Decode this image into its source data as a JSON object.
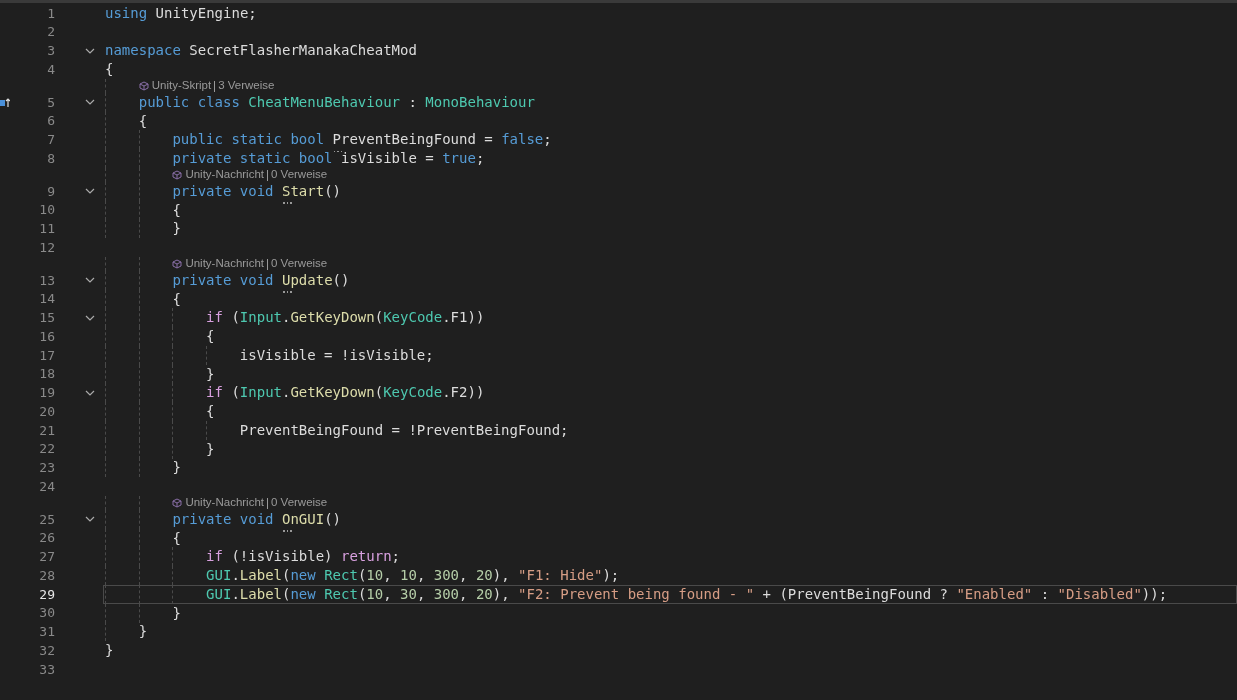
{
  "editor": {
    "lines": [
      {
        "number": "1",
        "foldable": false,
        "current": false,
        "tokens": [
          {
            "kind": "keyword",
            "text": "using"
          },
          {
            "kind": "plain",
            "text": " UnityEngine;"
          }
        ]
      },
      {
        "number": "2",
        "foldable": false,
        "current": false
      },
      {
        "number": "3",
        "foldable": true,
        "current": false,
        "tokens": [
          {
            "kind": "keyword",
            "text": "namespace"
          },
          {
            "kind": "plain",
            "text": " SecretFlasherManakaCheatMod"
          }
        ]
      },
      {
        "number": "4",
        "foldable": false,
        "current": false,
        "tokens": [
          {
            "kind": "plain",
            "text": "{"
          }
        ]
      },
      {
        "number": "5",
        "foldable": true,
        "current": false,
        "margin_icon": true,
        "codelens": {
          "label": "Unity-Skript",
          "references": "3 Verweise"
        },
        "tokens": [
          {
            "kind": "keyword",
            "text": "    public class"
          },
          {
            "kind": "type",
            "text": " CheatMenuBehaviour"
          },
          {
            "kind": "plain",
            "text": " : "
          },
          {
            "kind": "type",
            "text": "MonoBehaviour"
          }
        ]
      },
      {
        "number": "6",
        "foldable": false,
        "current": false,
        "tokens": [
          {
            "kind": "plain",
            "text": "    {"
          }
        ]
      },
      {
        "number": "7",
        "foldable": false,
        "current": false,
        "tokens": [
          {
            "kind": "keyword",
            "text": "        public static bool"
          },
          {
            "kind": "plain",
            "text": " PreventBeingFound",
            "hint": true
          },
          {
            "kind": "plain",
            "text": " = "
          },
          {
            "kind": "keyword",
            "text": "false"
          },
          {
            "kind": "plain",
            "text": ";"
          }
        ]
      },
      {
        "number": "8",
        "foldable": false,
        "current": false,
        "tokens": [
          {
            "kind": "keyword",
            "text": "        private static bool"
          },
          {
            "kind": "plain",
            "text": " isVisible = "
          },
          {
            "kind": "keyword",
            "text": "true"
          },
          {
            "kind": "plain",
            "text": ";"
          }
        ]
      },
      {
        "number": "9",
        "foldable": true,
        "current": false,
        "codelens": {
          "label": "Unity-Nachricht",
          "references": "0 Verweise"
        },
        "tokens": [
          {
            "kind": "keyword",
            "text": "        private void"
          },
          {
            "kind": "method",
            "text": " Start",
            "hint": true
          },
          {
            "kind": "plain",
            "text": "()"
          }
        ]
      },
      {
        "number": "10",
        "foldable": false,
        "current": false,
        "tokens": [
          {
            "kind": "plain",
            "text": "        {"
          }
        ]
      },
      {
        "number": "11",
        "foldable": false,
        "current": false,
        "tokens": [
          {
            "kind": "plain",
            "text": "        }"
          }
        ]
      },
      {
        "number": "12",
        "foldable": false,
        "current": false
      },
      {
        "number": "13",
        "foldable": true,
        "current": false,
        "codelens": {
          "label": "Unity-Nachricht",
          "references": "0 Verweise"
        },
        "tokens": [
          {
            "kind": "keyword",
            "text": "        private void"
          },
          {
            "kind": "method",
            "text": " Update",
            "hint": true
          },
          {
            "kind": "plain",
            "text": "()"
          }
        ]
      },
      {
        "number": "14",
        "foldable": false,
        "current": false,
        "tokens": [
          {
            "kind": "plain",
            "text": "        {"
          }
        ]
      },
      {
        "number": "15",
        "foldable": true,
        "current": false,
        "tokens": [
          {
            "kind": "control",
            "text": "            if"
          },
          {
            "kind": "plain",
            "text": " ("
          },
          {
            "kind": "type",
            "text": "Input"
          },
          {
            "kind": "plain",
            "text": "."
          },
          {
            "kind": "method",
            "text": "GetKeyDown"
          },
          {
            "kind": "plain",
            "text": "("
          },
          {
            "kind": "type",
            "text": "KeyCode"
          },
          {
            "kind": "plain",
            "text": ".F1))"
          }
        ]
      },
      {
        "number": "16",
        "foldable": false,
        "current": false,
        "tokens": [
          {
            "kind": "plain",
            "text": "            {"
          }
        ]
      },
      {
        "number": "17",
        "foldable": false,
        "current": false,
        "tokens": [
          {
            "kind": "plain",
            "text": "                isVisible = !isVisible;"
          }
        ]
      },
      {
        "number": "18",
        "foldable": false,
        "current": false,
        "tokens": [
          {
            "kind": "plain",
            "text": "            }"
          }
        ]
      },
      {
        "number": "19",
        "foldable": true,
        "current": false,
        "tokens": [
          {
            "kind": "control",
            "text": "            if"
          },
          {
            "kind": "plain",
            "text": " ("
          },
          {
            "kind": "type",
            "text": "Input"
          },
          {
            "kind": "plain",
            "text": "."
          },
          {
            "kind": "method",
            "text": "GetKeyDown"
          },
          {
            "kind": "plain",
            "text": "("
          },
          {
            "kind": "type",
            "text": "KeyCode"
          },
          {
            "kind": "plain",
            "text": ".F2))"
          }
        ]
      },
      {
        "number": "20",
        "foldable": false,
        "current": false,
        "tokens": [
          {
            "kind": "plain",
            "text": "            {"
          }
        ]
      },
      {
        "number": "21",
        "foldable": false,
        "current": false,
        "tokens": [
          {
            "kind": "plain",
            "text": "                PreventBeingFound = !PreventBeingFound;"
          }
        ]
      },
      {
        "number": "22",
        "foldable": false,
        "current": false,
        "tokens": [
          {
            "kind": "plain",
            "text": "            }"
          }
        ]
      },
      {
        "number": "23",
        "foldable": false,
        "current": false,
        "tokens": [
          {
            "kind": "plain",
            "text": "        }"
          }
        ]
      },
      {
        "number": "24",
        "foldable": false,
        "current": false
      },
      {
        "number": "25",
        "foldable": true,
        "current": false,
        "codelens": {
          "label": "Unity-Nachricht",
          "references": "0 Verweise"
        },
        "tokens": [
          {
            "kind": "keyword",
            "text": "        private void"
          },
          {
            "kind": "method",
            "text": " OnGUI",
            "hint": true
          },
          {
            "kind": "plain",
            "text": "()"
          }
        ]
      },
      {
        "number": "26",
        "foldable": false,
        "current": false,
        "tokens": [
          {
            "kind": "plain",
            "text": "        {"
          }
        ]
      },
      {
        "number": "27",
        "foldable": false,
        "current": false,
        "tokens": [
          {
            "kind": "control",
            "text": "            if"
          },
          {
            "kind": "plain",
            "text": " (!isVisible) "
          },
          {
            "kind": "control",
            "text": "return"
          },
          {
            "kind": "plain",
            "text": ";"
          }
        ]
      },
      {
        "number": "28",
        "foldable": false,
        "current": false,
        "tokens": [
          {
            "kind": "type",
            "text": "            GUI"
          },
          {
            "kind": "plain",
            "text": "."
          },
          {
            "kind": "method",
            "text": "Label"
          },
          {
            "kind": "plain",
            "text": "("
          },
          {
            "kind": "keyword",
            "text": "new"
          },
          {
            "kind": "type",
            "text": " Rect"
          },
          {
            "kind": "plain",
            "text": "("
          },
          {
            "kind": "number",
            "text": "10"
          },
          {
            "kind": "plain",
            "text": ", "
          },
          {
            "kind": "number",
            "text": "10"
          },
          {
            "kind": "plain",
            "text": ", "
          },
          {
            "kind": "number",
            "text": "300"
          },
          {
            "kind": "plain",
            "text": ", "
          },
          {
            "kind": "number",
            "text": "20"
          },
          {
            "kind": "plain",
            "text": "), "
          },
          {
            "kind": "string",
            "text": "\"F1: Hide\""
          },
          {
            "kind": "plain",
            "text": ");"
          }
        ]
      },
      {
        "number": "29",
        "foldable": false,
        "current": true,
        "tokens": [
          {
            "kind": "type",
            "text": "            GUI"
          },
          {
            "kind": "plain",
            "text": "."
          },
          {
            "kind": "method",
            "text": "Label"
          },
          {
            "kind": "plain",
            "text": "("
          },
          {
            "kind": "keyword",
            "text": "new"
          },
          {
            "kind": "type",
            "text": " Rect"
          },
          {
            "kind": "plain",
            "text": "("
          },
          {
            "kind": "number",
            "text": "10"
          },
          {
            "kind": "plain",
            "text": ", "
          },
          {
            "kind": "number",
            "text": "30"
          },
          {
            "kind": "plain",
            "text": ", "
          },
          {
            "kind": "number",
            "text": "300"
          },
          {
            "kind": "plain",
            "text": ", "
          },
          {
            "kind": "number",
            "text": "20"
          },
          {
            "kind": "plain",
            "text": "), "
          },
          {
            "kind": "string",
            "text": "\"F2: Prevent being found - \""
          },
          {
            "kind": "plain",
            "text": " + (PreventBeingFound ? "
          },
          {
            "kind": "string",
            "text": "\"Enabled\""
          },
          {
            "kind": "plain",
            "text": " : "
          },
          {
            "kind": "string",
            "text": "\"Disabled\""
          },
          {
            "kind": "plain",
            "text": "));"
          }
        ]
      },
      {
        "number": "30",
        "foldable": false,
        "current": false,
        "tokens": [
          {
            "kind": "plain",
            "text": "        }"
          }
        ]
      },
      {
        "number": "31",
        "foldable": false,
        "current": false,
        "tokens": [
          {
            "kind": "plain",
            "text": "    }"
          }
        ]
      },
      {
        "number": "32",
        "foldable": false,
        "current": false,
        "tokens": [
          {
            "kind": "plain",
            "text": "}"
          }
        ]
      },
      {
        "number": "33",
        "foldable": false,
        "current": false
      }
    ]
  }
}
